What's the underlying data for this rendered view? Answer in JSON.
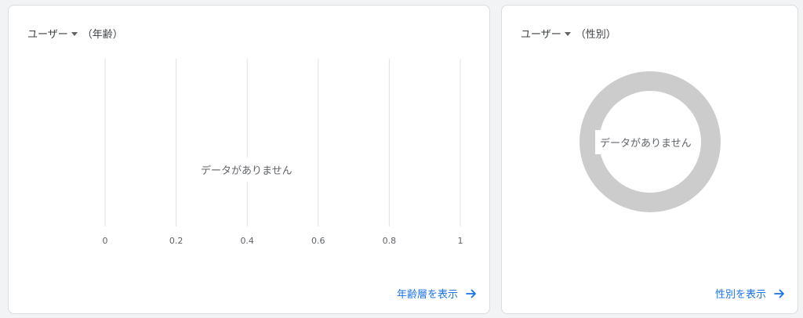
{
  "age_card": {
    "metric_label": "ユーザー",
    "dimension_label": "（年齢）",
    "no_data_text": "データがありません",
    "view_link_label": "年齢層を表示",
    "axis_ticks": [
      "0",
      "0.2",
      "0.4",
      "0.6",
      "0.8",
      "1"
    ]
  },
  "gender_card": {
    "metric_label": "ユーザー",
    "dimension_label": "（性別）",
    "no_data_text": "データがありません",
    "view_link_label": "性別を表示"
  },
  "colors": {
    "link": "#1a73e8",
    "gridline": "#e0e0e0",
    "donut_empty": "#cccccc"
  },
  "icons": {
    "dropdown": "caret-down-icon",
    "link_arrow": "arrow-right-icon"
  }
}
